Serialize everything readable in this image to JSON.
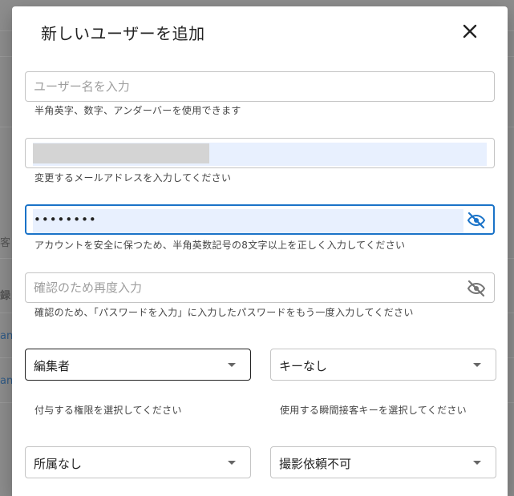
{
  "dialog": {
    "title": "新しいユーザーを追加",
    "close_icon": "close-icon"
  },
  "background": {
    "fragments": [
      "客",
      "録",
      "an",
      "an"
    ]
  },
  "fields": {
    "username": {
      "placeholder": "ユーザー名を入力",
      "value": "",
      "helper": "半角英字、数字、アンダーバーを使用できます"
    },
    "email": {
      "value": "",
      "helper": "変更するメールアドレスを入力してください"
    },
    "password": {
      "value": "••••••••",
      "helper": "アカウントを安全に保つため、半角英数記号の8文字以上を正しく入力してください",
      "icon": "eye-icon"
    },
    "password_confirm": {
      "placeholder": "確認のため再度入力",
      "value": "",
      "helper": "確認のため、「パスワードを入力」に入力したパスワードをもう一度入力してください",
      "icon": "eye-icon"
    }
  },
  "selects": {
    "role": {
      "value": "編集者",
      "helper": "付与する権限を選択してください"
    },
    "instant_key": {
      "value": "キーなし",
      "helper": "使用する瞬間接客キーを選択してください"
    },
    "affiliation": {
      "value": "所属なし"
    },
    "shoot_request": {
      "value": "撮影依頼不可"
    }
  },
  "colors": {
    "accent": "#1a73c8",
    "autofill": "#e8f0fe",
    "backdrop": "#8d8d8d"
  }
}
